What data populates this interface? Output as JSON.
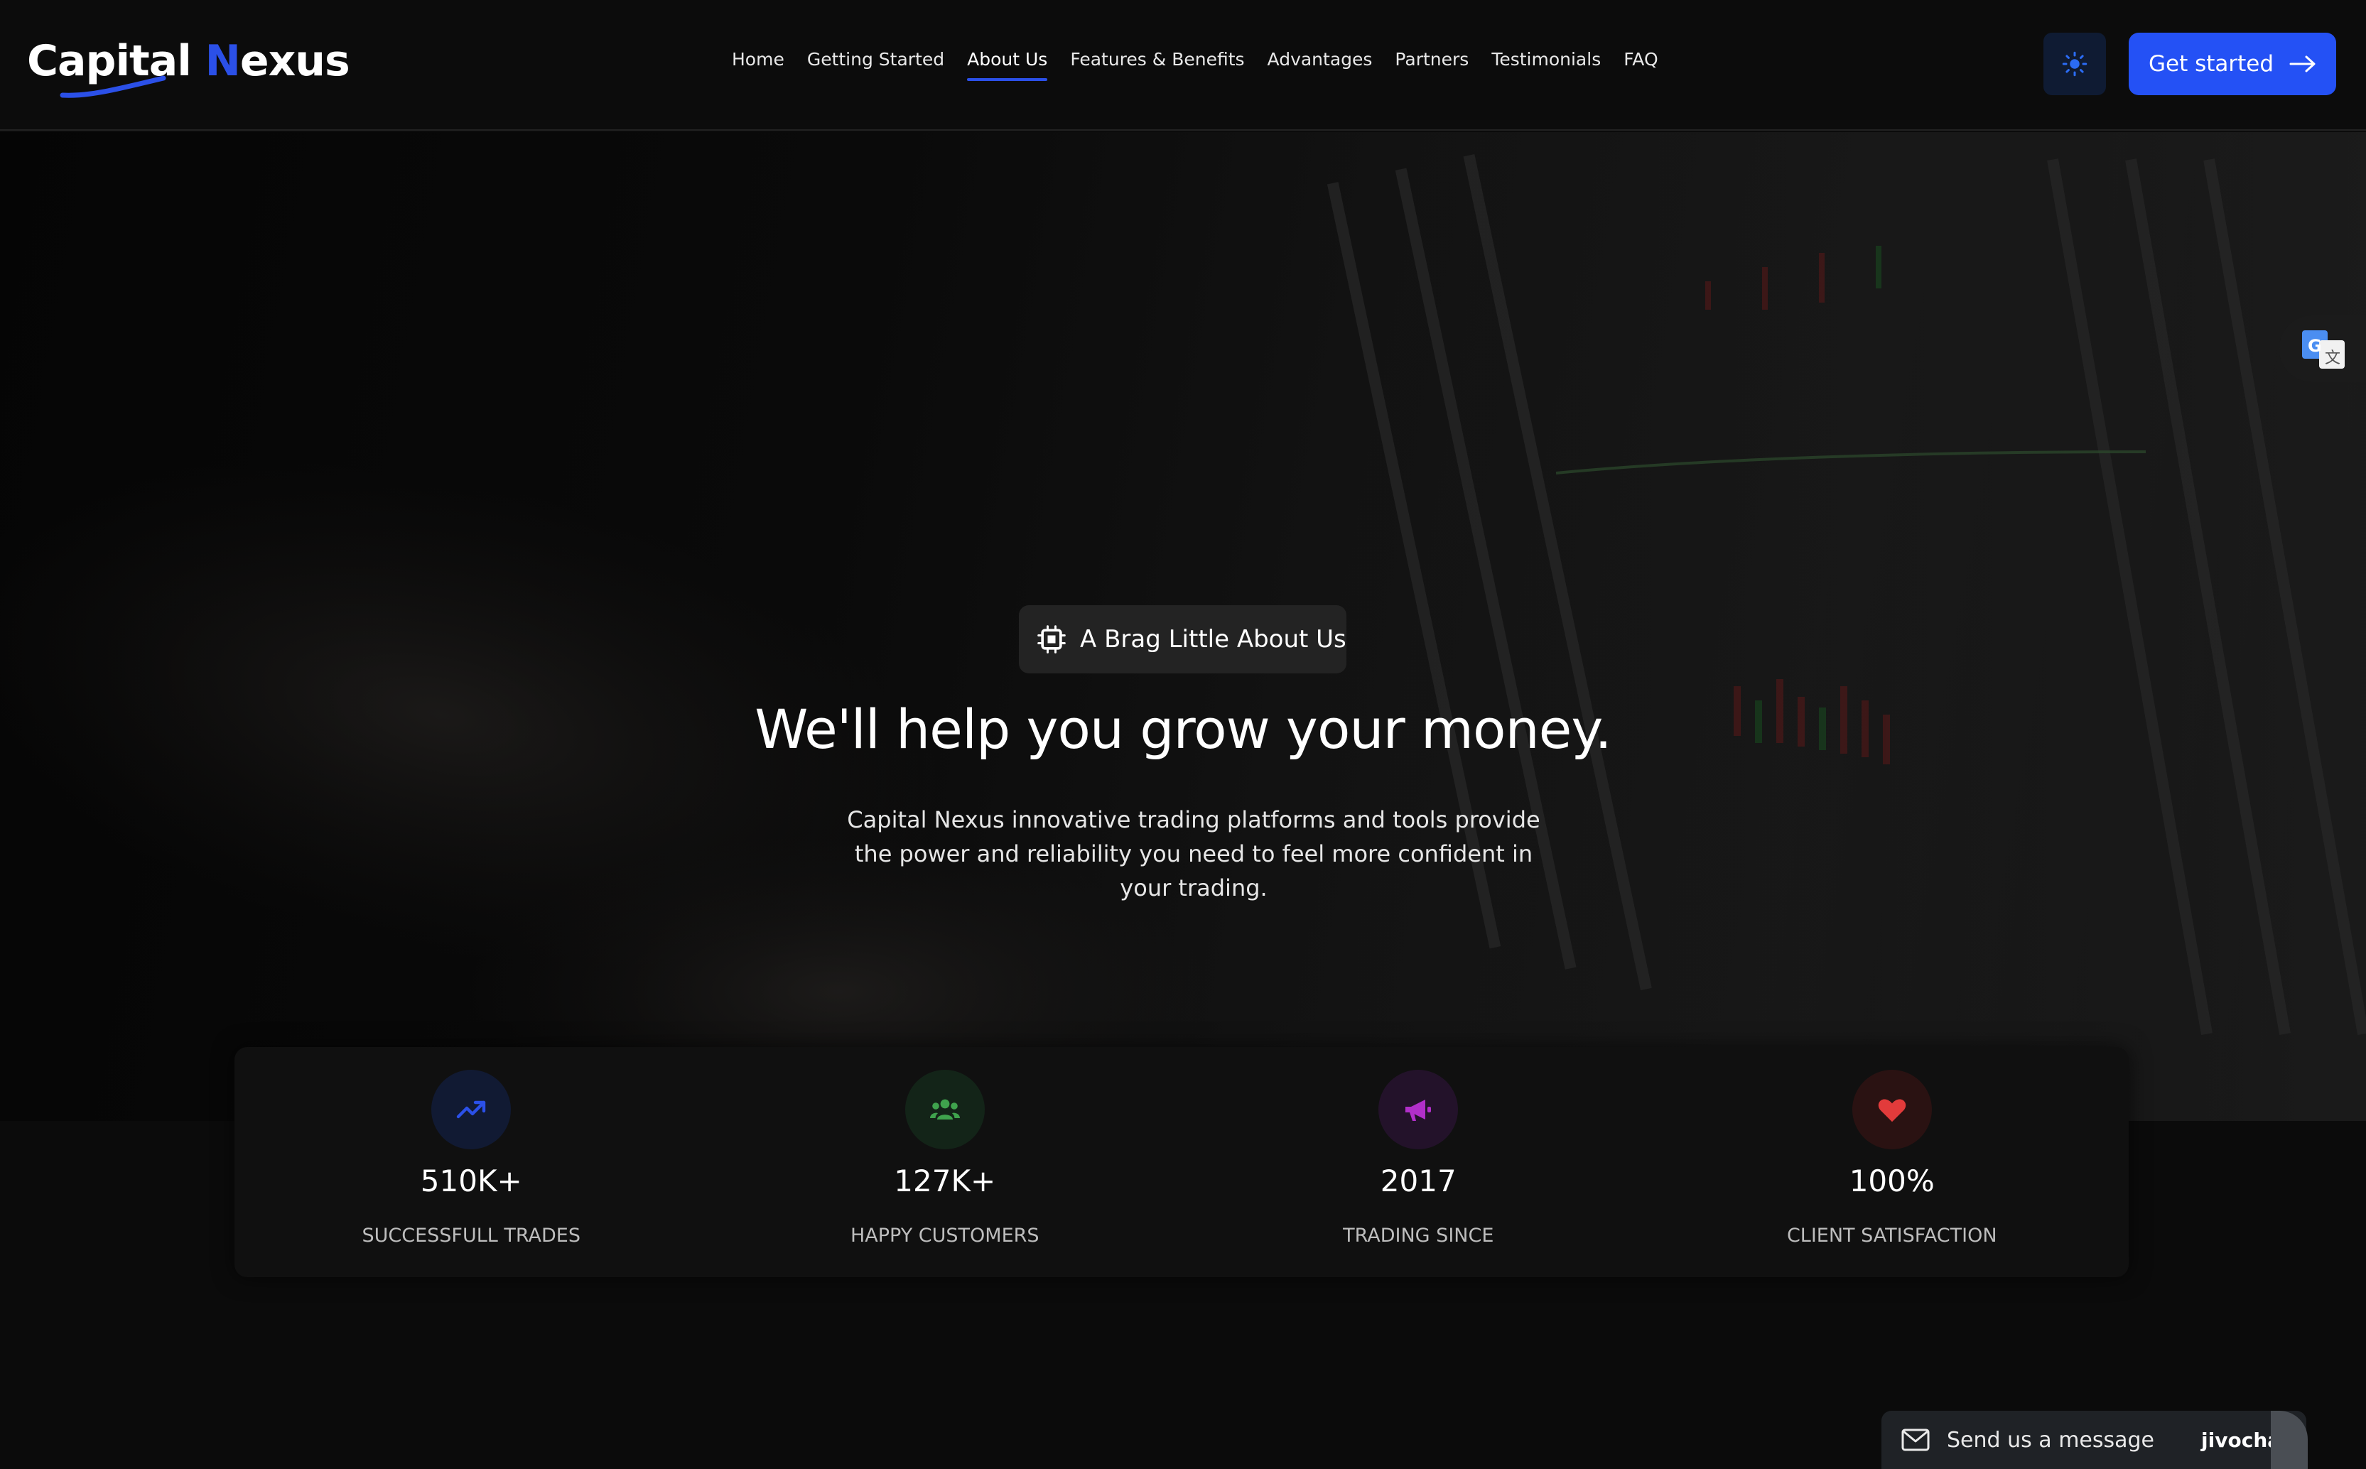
{
  "header": {
    "logo": {
      "part1": "Capital ",
      "part2": "N",
      "part3": "exus"
    },
    "nav": [
      {
        "label": "Home"
      },
      {
        "label": "Getting Started"
      },
      {
        "label": "About Us",
        "active": true
      },
      {
        "label": "Features & Benefits"
      },
      {
        "label": "Advantages"
      },
      {
        "label": "Partners"
      },
      {
        "label": "Testimonials"
      },
      {
        "label": "FAQ"
      }
    ],
    "theme_toggle_icon": "sun-icon",
    "cta_label": "Get started",
    "cta_icon": "arrow-right-icon"
  },
  "hero": {
    "badge_icon": "chip-icon",
    "badge_label": "A Brag Little About Us",
    "title": "We'll help you grow your money.",
    "description": "Capital Nexus innovative trading platforms and tools provide the power and reliability you need to feel more confident in your trading."
  },
  "stats": [
    {
      "icon": "trending-up-icon",
      "value": "510K+",
      "label": "SUCCESSFULL TRADES",
      "color": "#2b50e8",
      "bg": "#111a33"
    },
    {
      "icon": "users-icon",
      "value": "127K+",
      "label": "HAPPY CUSTOMERS",
      "color": "#3fa34d",
      "bg": "#132418"
    },
    {
      "icon": "megaphone-icon",
      "value": "2017",
      "label": "TRADING SINCE",
      "color": "#b12fc9",
      "bg": "#23122a"
    },
    {
      "icon": "heart-icon",
      "value": "100%",
      "label": "CLIENT SATISFACTION",
      "color": "#e23b3b",
      "bg": "#2a1212"
    }
  ],
  "chat": {
    "label": "Send us a message",
    "brand": "jivochat"
  },
  "colors": {
    "accent": "#2451f5",
    "background": "#0b0b0b"
  }
}
